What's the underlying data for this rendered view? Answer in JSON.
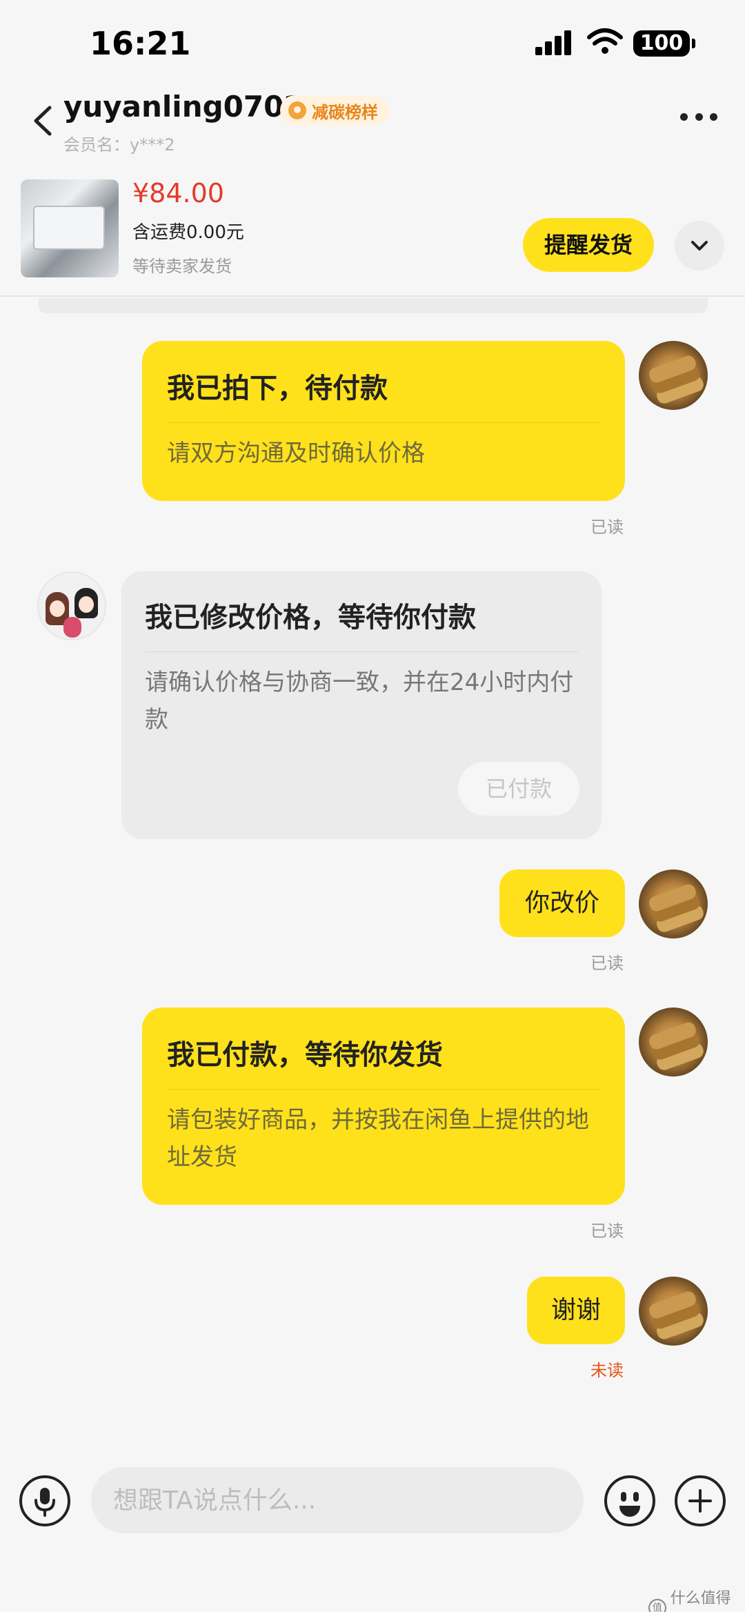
{
  "status_bar": {
    "time": "16:21",
    "battery": "100"
  },
  "header": {
    "username": "yuyanling0702",
    "badge": "减碳榜样",
    "member_label": "会员名：",
    "member_value": "y***2"
  },
  "product": {
    "price": "¥84.00",
    "shipping": "含运费0.00元",
    "status": "等待卖家发货",
    "remind_button": "提醒发货"
  },
  "messages": [
    {
      "title": "我已拍下，待付款",
      "desc": "请双方沟通及时确认价格",
      "read": "已读"
    },
    {
      "title": "我已修改价格，等待你付款",
      "desc": "请确认价格与协商一致，并在24小时内付款",
      "button": "已付款"
    },
    {
      "text": "你改价",
      "read": "已读"
    },
    {
      "title": "我已付款，等待你发货",
      "desc": "请包装好商品，并按我在闲鱼上提供的地址发货",
      "read": "已读"
    },
    {
      "text": "谢谢",
      "read": "未读"
    }
  ],
  "input": {
    "placeholder": "想跟TA说点什么..."
  },
  "watermark": {
    "text": "什么值得买",
    "logo": "值"
  }
}
